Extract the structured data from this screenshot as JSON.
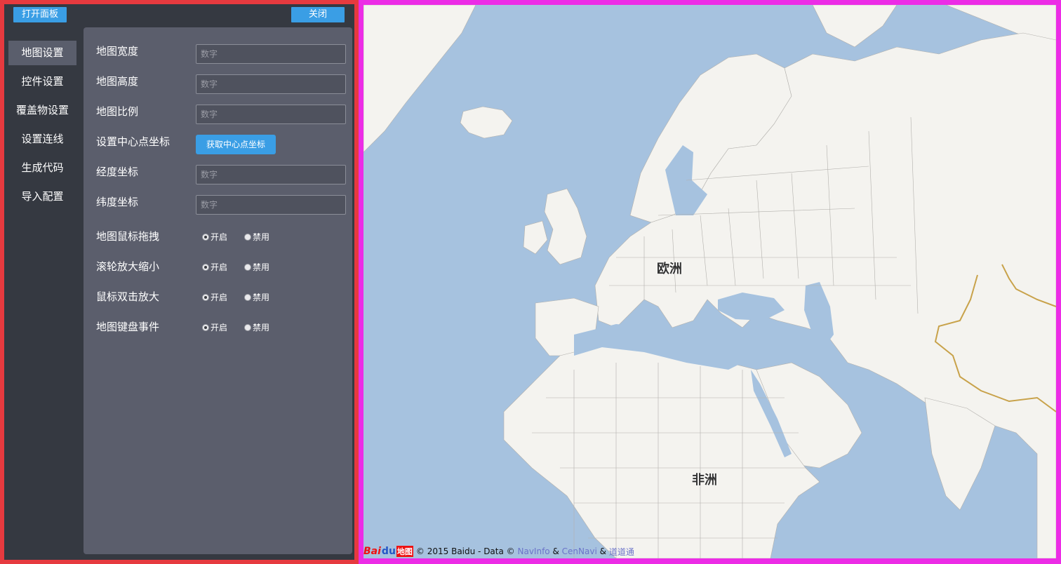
{
  "panel": {
    "open_btn": "打开面板",
    "close_btn": "关闭",
    "nav": [
      {
        "label": "地图设置",
        "active": true
      },
      {
        "label": "控件设置",
        "active": false
      },
      {
        "label": "覆盖物设置",
        "active": false
      },
      {
        "label": "设置连线",
        "active": false
      },
      {
        "label": "生成代码",
        "active": false
      },
      {
        "label": "导入配置",
        "active": false
      }
    ],
    "fields": {
      "width": {
        "label": "地图宽度",
        "placeholder": "数字"
      },
      "height": {
        "label": "地图高度",
        "placeholder": "数字"
      },
      "scale": {
        "label": "地图比例",
        "placeholder": "数字"
      },
      "center": {
        "label": "设置中心点坐标",
        "button": "获取中心点坐标"
      },
      "lng": {
        "label": "经度坐标",
        "placeholder": "数字"
      },
      "lat": {
        "label": "纬度坐标",
        "placeholder": "数字"
      }
    },
    "toggles": [
      {
        "label": "地图鼠标拖拽",
        "on": "开启",
        "off": "禁用",
        "selected": "开启"
      },
      {
        "label": "滚轮放大缩小",
        "on": "开启",
        "off": "禁用",
        "selected": "开启"
      },
      {
        "label": "鼠标双击放大",
        "on": "开启",
        "off": "禁用",
        "selected": "开启"
      },
      {
        "label": "地图键盘事件",
        "on": "开启",
        "off": "禁用",
        "selected": "开启"
      }
    ],
    "colors": {
      "accent": "#3a9ee5",
      "frame": "#e63a3f",
      "panel_bg": "#353941",
      "card_bg": "#5b5e6c"
    }
  },
  "map": {
    "labels": {
      "europe": "欧洲",
      "africa": "非洲"
    },
    "footer": {
      "logo_bai": "Bai",
      "logo_paw": "du",
      "logo_map": "地图",
      "copyright": "© 2015 Baidu - Data ©",
      "navinfo": "NavInfo",
      "amp1": "&",
      "cennavi": "CenNavi",
      "amp2": "&",
      "daodaotong": "道道通"
    },
    "colors": {
      "sea": "#a6c2df",
      "land": "#f4f3ef",
      "border": "#b2b0ac",
      "china_border": "#c8a24a",
      "frame": "#ec2ce6"
    }
  }
}
